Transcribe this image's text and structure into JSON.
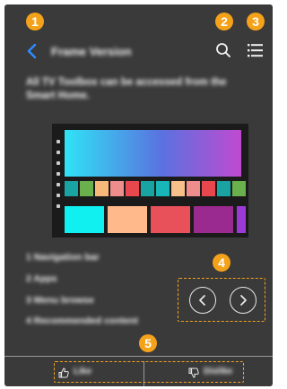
{
  "header": {
    "title": "Frame Version",
    "back_icon": "chevron-left-icon",
    "search_icon": "search-icon",
    "menu_icon": "list-menu-icon"
  },
  "description": "All TV Toolbox can be accessed from the Smart Home.",
  "steps": [
    "1 Navigation bar",
    "2 Apps",
    "3 Menu browse",
    "4 Recommended content"
  ],
  "footer": {
    "like_label": "Like",
    "dislike_label": "Dislike"
  },
  "callouts": [
    "1",
    "2",
    "3",
    "4",
    "5"
  ],
  "colors": {
    "background": "#3a3a3a",
    "accent": "#2f8cff",
    "callout": "#f5a21b",
    "text": "#f2f2f2"
  },
  "screen": {
    "swatches": [
      "#1aa3a3",
      "#6ab04c",
      "#f6b97a",
      "#ef8d8d",
      "#e8474d",
      "#1aa3a3",
      "#18b6b6",
      "#f7c08a",
      "#ef8d8d",
      "#e8474d",
      "#1aa3a3",
      "#6ab04c"
    ],
    "tiles": [
      "#10f0f0",
      "#ffb98a",
      "#e8505a",
      "#9a2a8f",
      "#9b3ad6"
    ],
    "gradient_colors": [
      "#2fe3f5",
      "#5a72e0",
      "#c04ad0"
    ]
  }
}
